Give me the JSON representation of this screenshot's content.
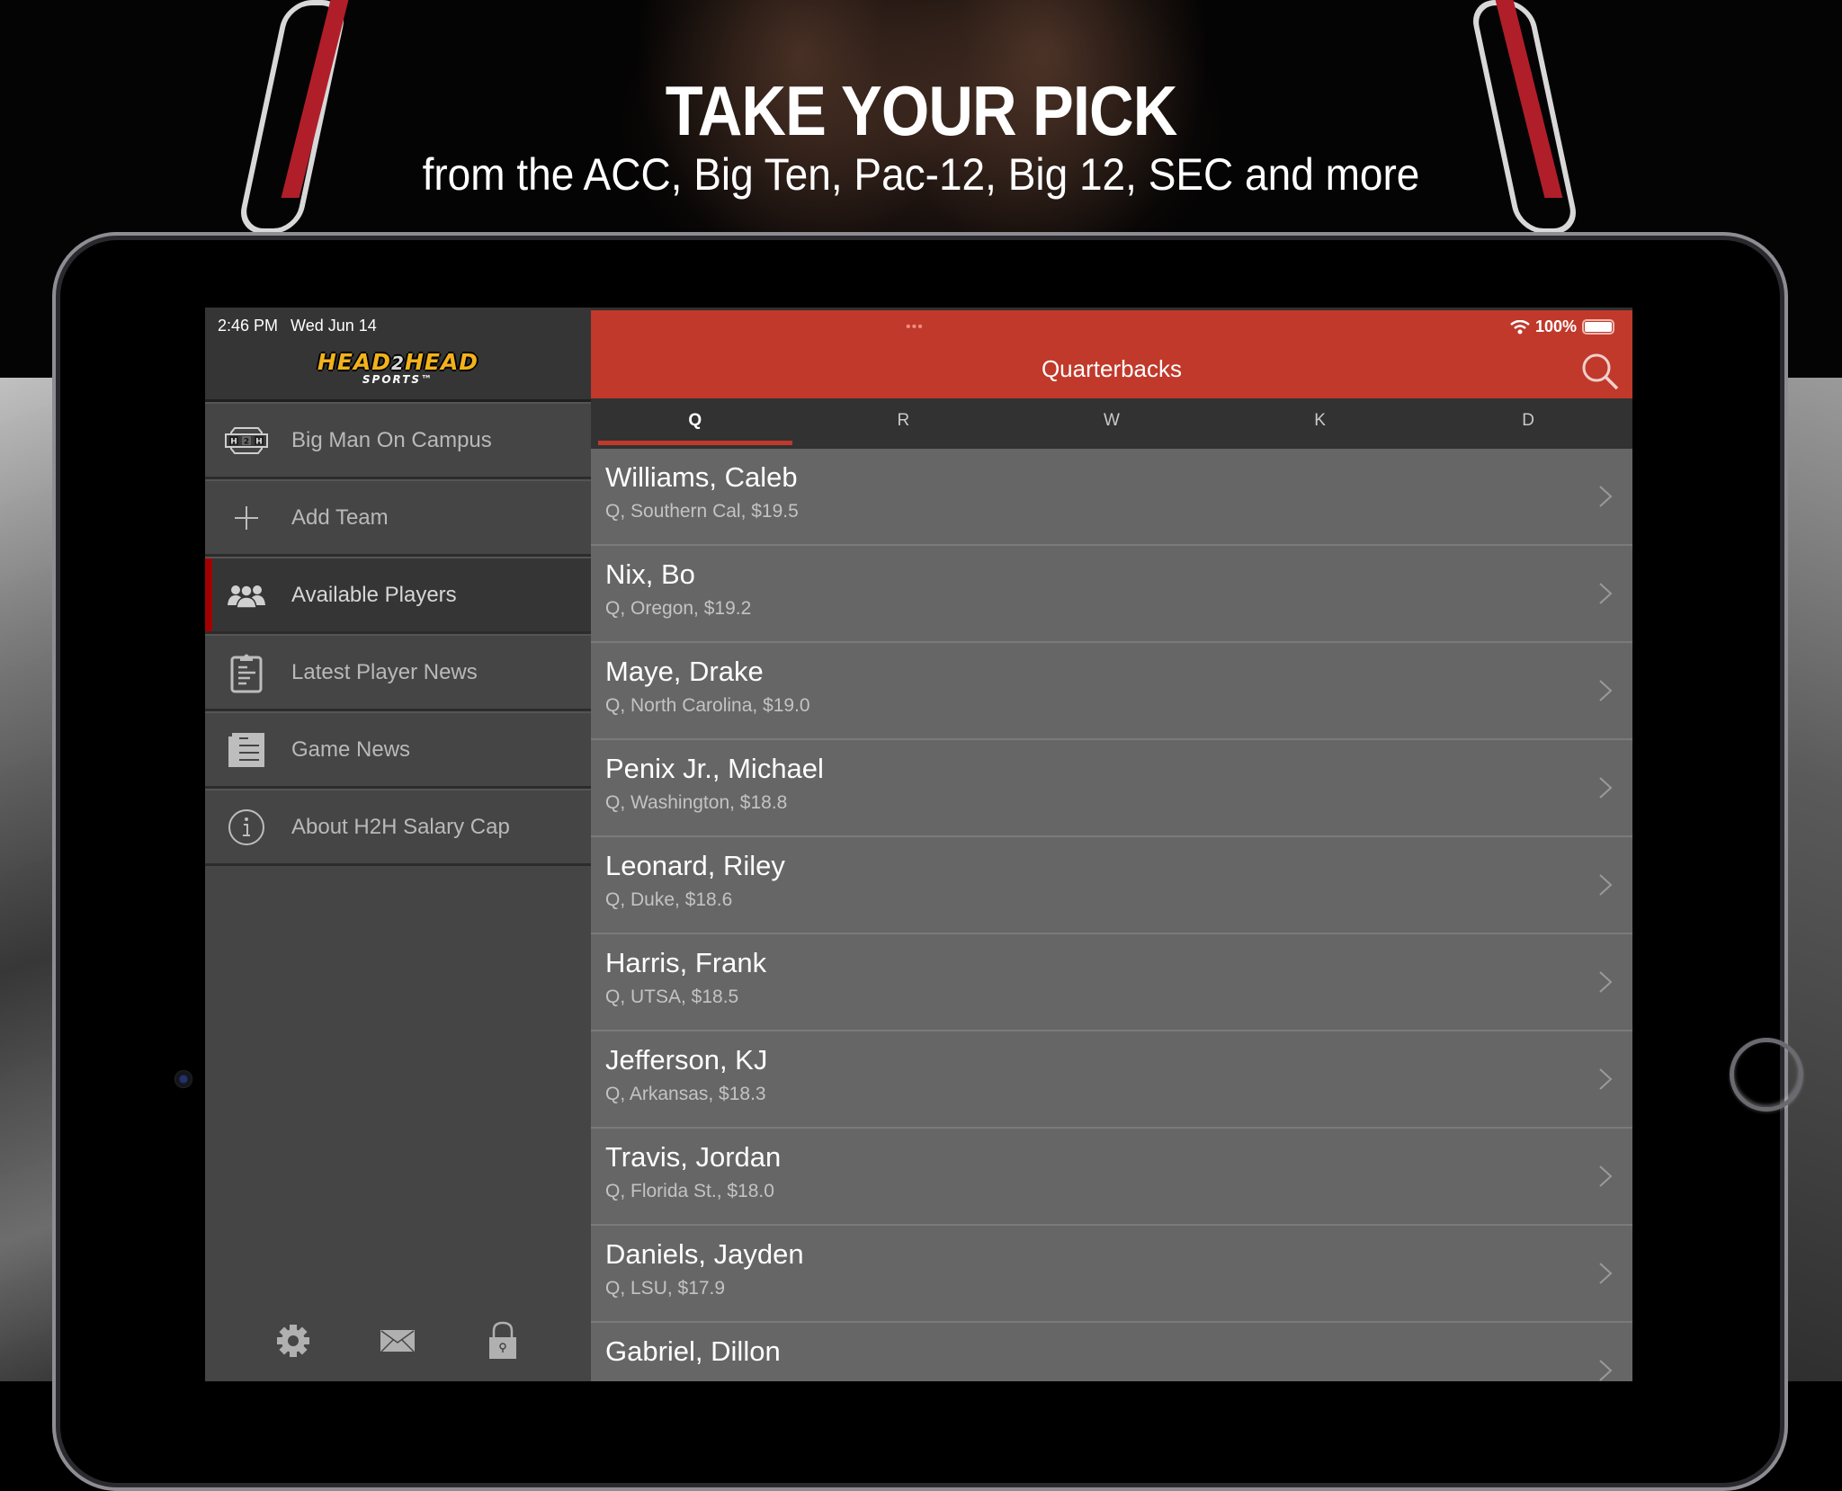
{
  "promo": {
    "title": "TAKE YOUR PICK",
    "subtitle": "from the ACC, Big Ten, Pac-12, Big 12, SEC and more"
  },
  "status_bar": {
    "time": "2:46 PM",
    "date": "Wed Jun 14",
    "battery": "100%",
    "multitask": "•••"
  },
  "logo": {
    "part1": "HEAD",
    "part2": "2",
    "part3": "HEAD",
    "sub": "SPORTS™"
  },
  "sidebar": {
    "items": [
      {
        "label": "Big Man On Campus",
        "icon": "h2h-badge-icon",
        "active": false
      },
      {
        "label": "Add Team",
        "icon": "plus-icon",
        "active": false
      },
      {
        "label": "Available Players",
        "icon": "players-group-icon",
        "active": true
      },
      {
        "label": "Latest Player News",
        "icon": "clipboard-icon",
        "active": false
      },
      {
        "label": "Game News",
        "icon": "newspaper-icon",
        "active": false
      },
      {
        "label": "About H2H Salary Cap",
        "icon": "info-icon",
        "active": false
      }
    ],
    "footer": [
      "gear-icon",
      "mail-icon",
      "lock-icon"
    ]
  },
  "header": {
    "title": "Quarterbacks",
    "search_icon": "search-icon"
  },
  "tabs": [
    {
      "label": "Q",
      "active": true
    },
    {
      "label": "R",
      "active": false
    },
    {
      "label": "W",
      "active": false
    },
    {
      "label": "K",
      "active": false
    },
    {
      "label": "D",
      "active": false
    }
  ],
  "players": [
    {
      "name": "Williams, Caleb",
      "detail": "Q, Southern Cal, $19.5"
    },
    {
      "name": "Nix, Bo",
      "detail": "Q, Oregon, $19.2"
    },
    {
      "name": "Maye, Drake",
      "detail": "Q, North Carolina, $19.0"
    },
    {
      "name": "Penix Jr., Michael",
      "detail": "Q, Washington, $18.8"
    },
    {
      "name": "Leonard, Riley",
      "detail": "Q, Duke, $18.6"
    },
    {
      "name": "Harris, Frank",
      "detail": "Q, UTSA, $18.5"
    },
    {
      "name": "Jefferson, KJ",
      "detail": "Q, Arkansas, $18.3"
    },
    {
      "name": "Travis, Jordan",
      "detail": "Q, Florida St., $18.0"
    },
    {
      "name": "Daniels, Jayden",
      "detail": "Q, LSU, $17.9"
    },
    {
      "name": "Gabriel, Dillon",
      "detail": ""
    }
  ],
  "colors": {
    "accent": "#c0392b",
    "active_marker": "#a30000",
    "logo_gold": "#f2b21c"
  }
}
